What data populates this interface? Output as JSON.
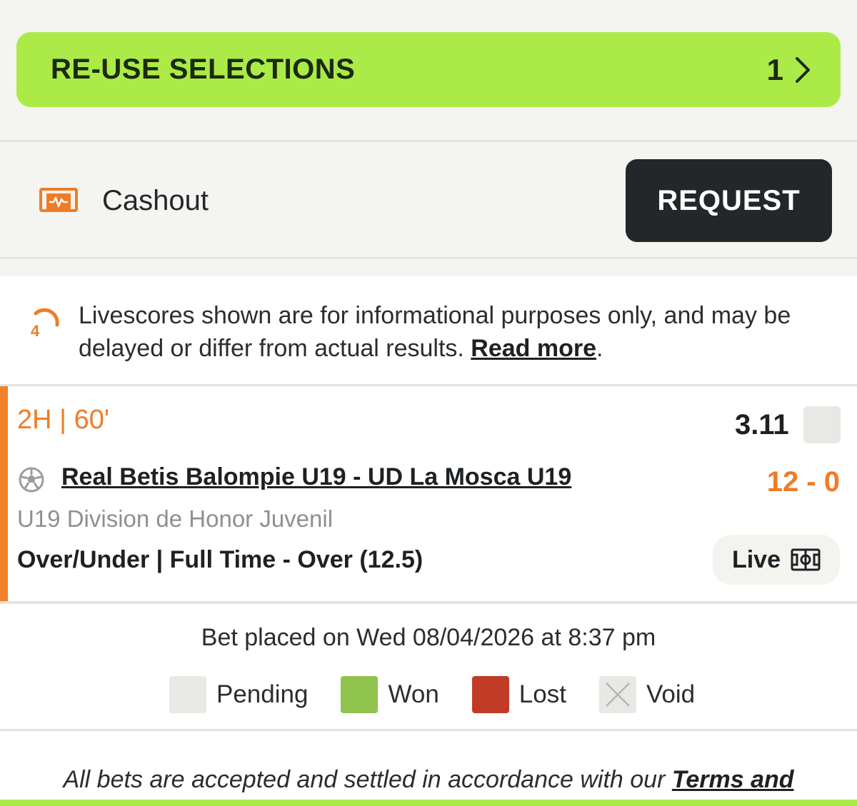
{
  "reuse": {
    "label": "RE-USE SELECTIONS",
    "count": "1",
    "chevron_icon": "chevron-right-icon"
  },
  "cashout": {
    "icon": "cashout-icon",
    "label": "Cashout",
    "request_label": "REQUEST"
  },
  "notice": {
    "icon": "livescore-clock-icon",
    "icon_number": "4",
    "text": "Livescores shown are for informational purposes only, and may be delayed or differ from actual results. ",
    "link": "Read more",
    "end": "."
  },
  "bet": {
    "time": "2H | 60'",
    "odds": "3.11",
    "sport_icon": "football-icon",
    "match": "Real Betis Balompie U19 - UD La Mosca U19",
    "score": "12 - 0",
    "league": "U19 Division de Honor Juvenil",
    "market": "Over/Under | Full Time - Over (12.5)",
    "live_label": "Live",
    "live_icon": "pitch-icon"
  },
  "placed": "Bet placed on Wed 08/04/2026 at 8:37 pm",
  "legend": {
    "pending": "Pending",
    "won": "Won",
    "lost": "Lost",
    "void": "Void"
  },
  "footer": {
    "text": "All bets are accepted and settled in accordance with our ",
    "link": "Terms and"
  },
  "colors": {
    "accent_green": "#acea47",
    "accent_orange": "#ef7c25",
    "dark": "#23272a",
    "won": "#8fc34d",
    "lost": "#c23b27",
    "pending": "#e8e8e4"
  }
}
